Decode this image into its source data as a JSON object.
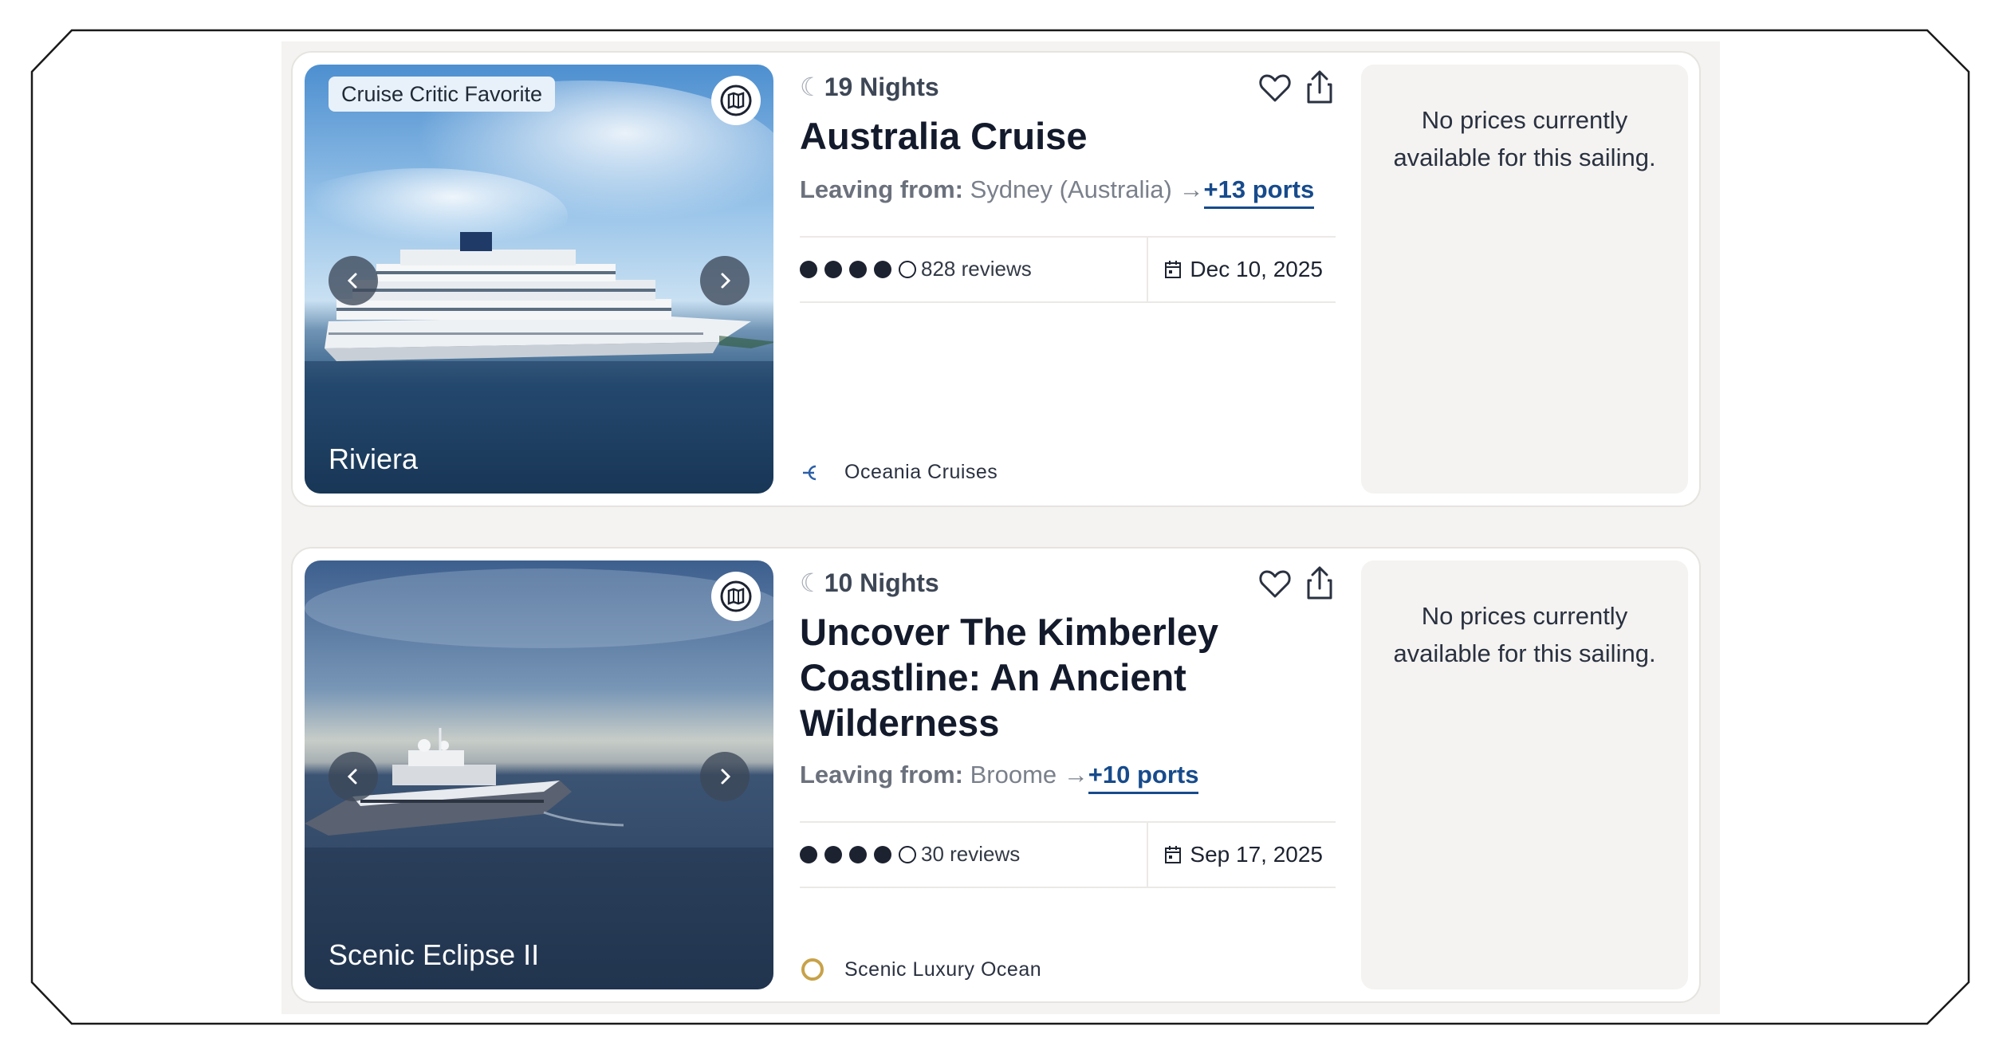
{
  "cards": [
    {
      "badge": "Cruise Critic Favorite",
      "ship_name": "Riviera",
      "nights": "19 Nights",
      "title": "Australia Cruise",
      "leaving_label": "Leaving from:",
      "leaving_from": "Sydney (Australia)",
      "arrow": "→",
      "ports": "+13 ports",
      "rating": {
        "filled": 4,
        "total": 5
      },
      "reviews": "828 reviews",
      "date": "Dec 10, 2025",
      "cruise_line": "Oceania Cruises",
      "cruise_line_icon": "oceania-logo-icon",
      "price_message": "No prices currently available for this sailing."
    },
    {
      "badge": "",
      "ship_name": "Scenic Eclipse II",
      "nights": "10 Nights",
      "title": "Uncover The Kimberley Coastline: An Ancient Wilderness",
      "leaving_label": "Leaving from:",
      "leaving_from": "Broome",
      "arrow": "→",
      "ports": "+10 ports",
      "rating": {
        "filled": 4,
        "total": 5
      },
      "reviews": "30 reviews",
      "date": "Sep 17, 2025",
      "cruise_line": "Scenic Luxury Ocean",
      "cruise_line_icon": "scenic-logo-icon",
      "price_message": "No prices currently available for this sailing."
    }
  ],
  "colors": {
    "accent_link": "#174b8c",
    "heading": "#131a2b",
    "panel_bg": "#f4f3f1",
    "badge_bg": "#e8f1fa",
    "scenic_gold": "#c8a24a"
  }
}
